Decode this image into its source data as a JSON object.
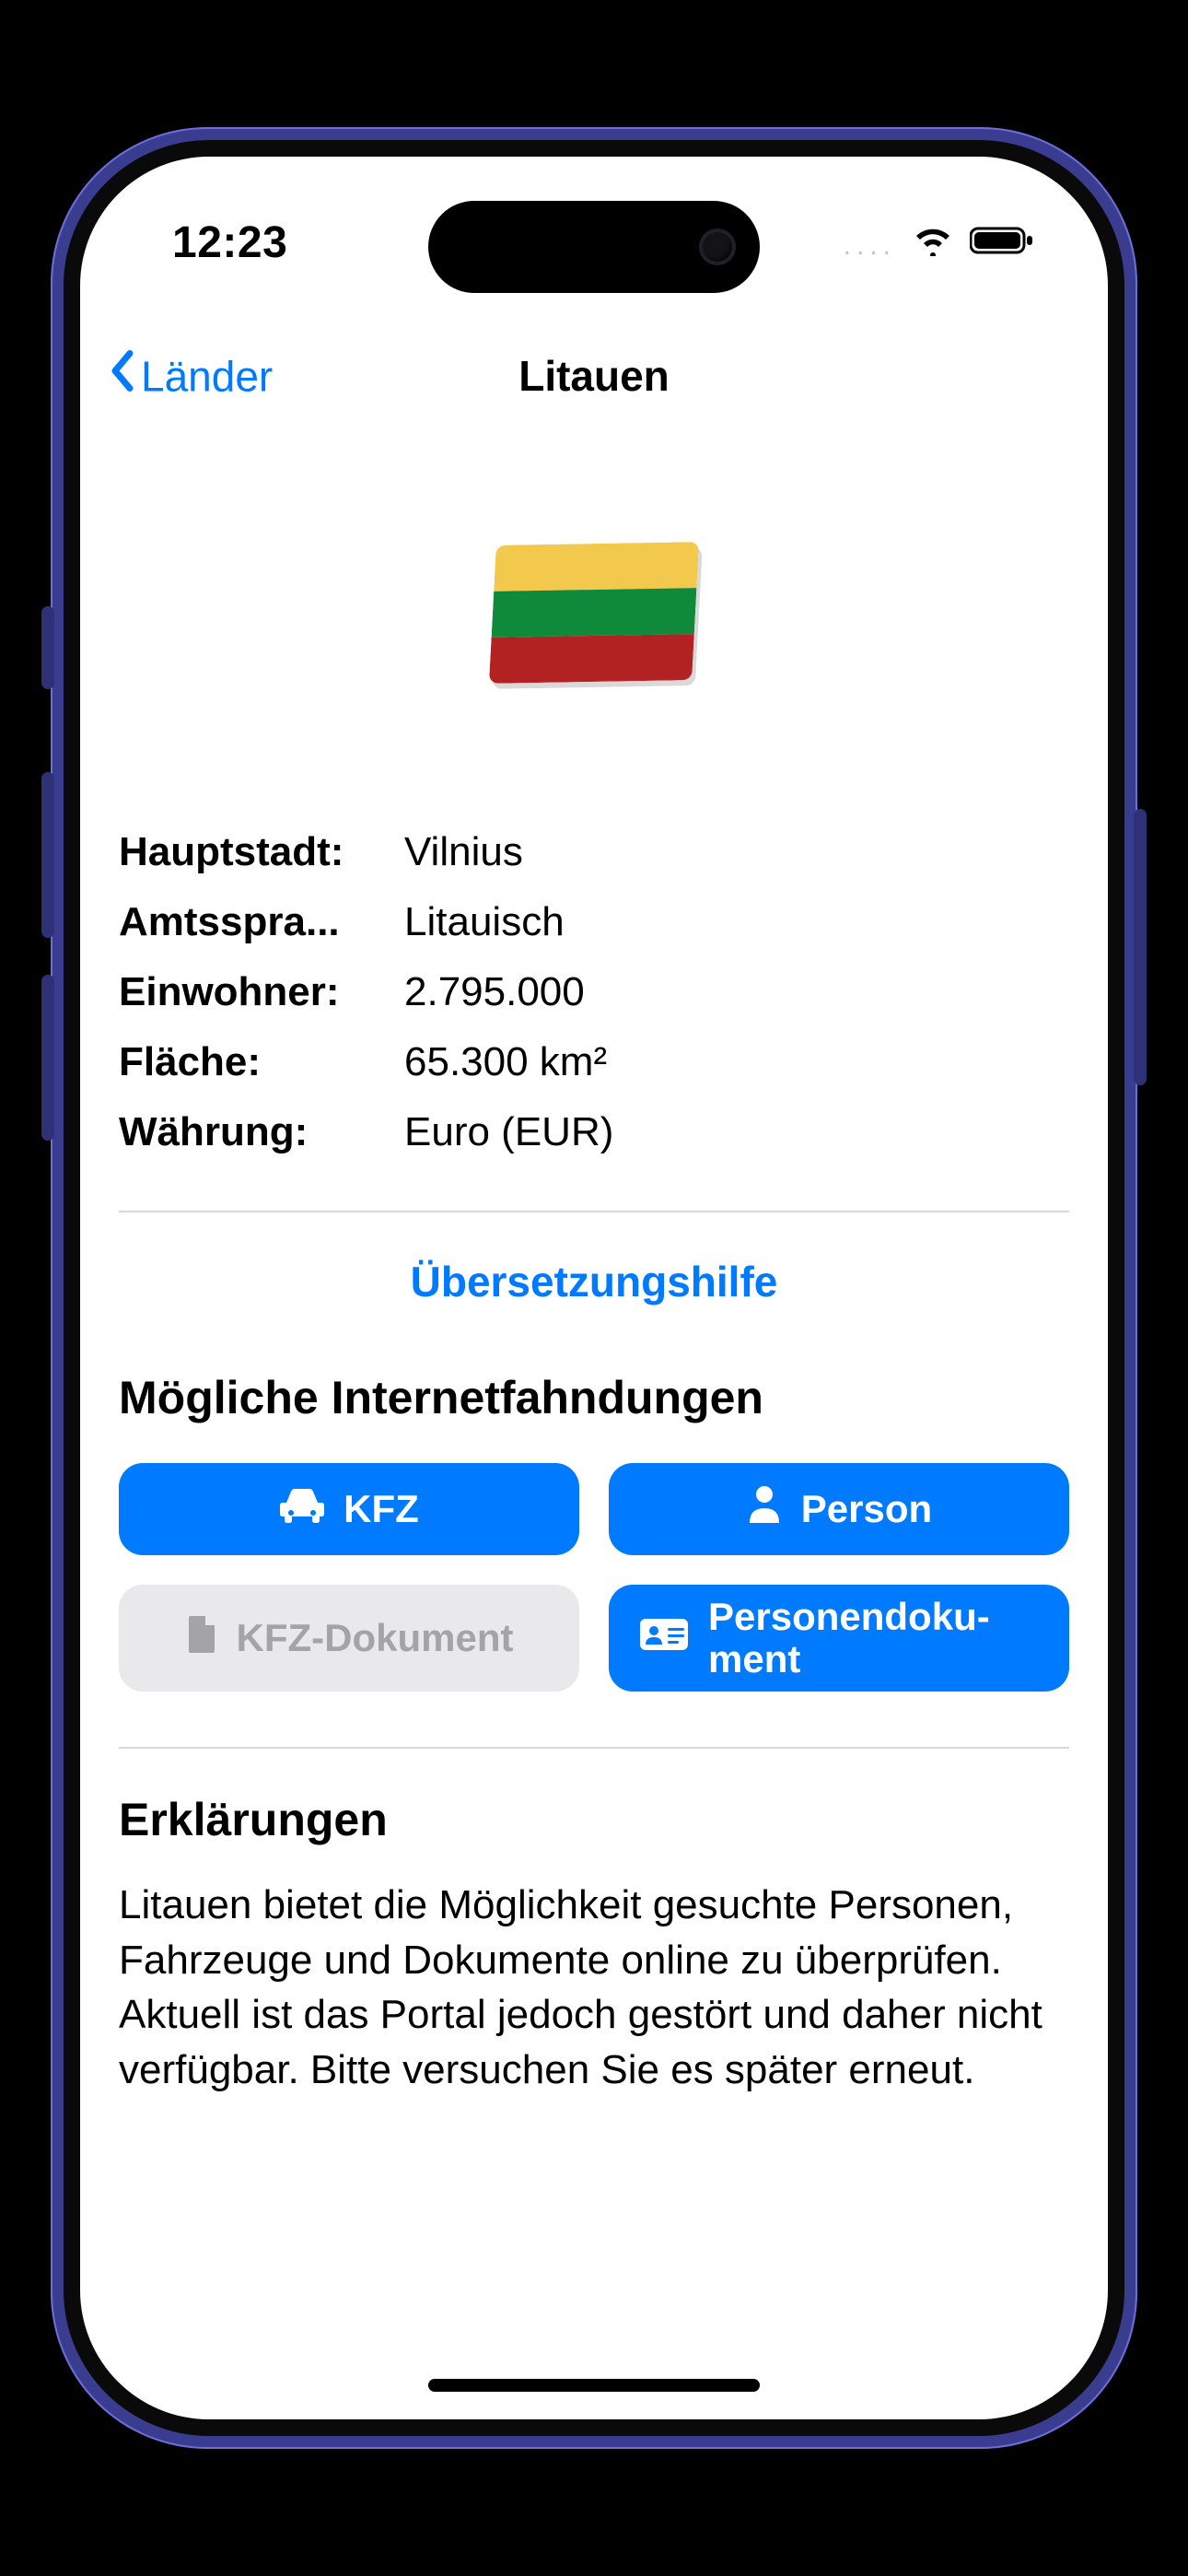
{
  "status": {
    "time": "12:23",
    "dots": "...."
  },
  "nav": {
    "back_label": "Länder",
    "title": "Litauen"
  },
  "flag": {
    "stripes": [
      "#f2c94c",
      "#0f8a3a",
      "#b22222"
    ]
  },
  "info": [
    {
      "label": "Hauptstadt:",
      "value": "Vilnius"
    },
    {
      "label": "Amtsspra...",
      "value": "Litauisch"
    },
    {
      "label": "Einwohner:",
      "value": "2.795.000"
    },
    {
      "label": "Fläche:",
      "value": "65.300 km²"
    },
    {
      "label": "Währung:",
      "value": "Euro (EUR)"
    }
  ],
  "translate_link": "Übersetzungshilfe",
  "searches": {
    "heading": "Mögliche Internetfahndungen",
    "items": [
      {
        "label": "KFZ",
        "enabled": true,
        "icon": "car-icon"
      },
      {
        "label": "Person",
        "enabled": true,
        "icon": "person-icon"
      },
      {
        "label": "KFZ-Dokument",
        "enabled": false,
        "icon": "document-icon"
      },
      {
        "label": "Personendoku­ment",
        "enabled": true,
        "icon": "id-card-icon"
      }
    ]
  },
  "explanations": {
    "heading": "Erklärungen",
    "body": "Litauen bietet die Möglichkeit gesuchte Personen, Fahrzeuge und Dokumente online zu überprüfen. Aktuell ist das Portal jedoch gestört und daher nicht verfügbar. Bitte versuchen Sie es später erneut."
  }
}
